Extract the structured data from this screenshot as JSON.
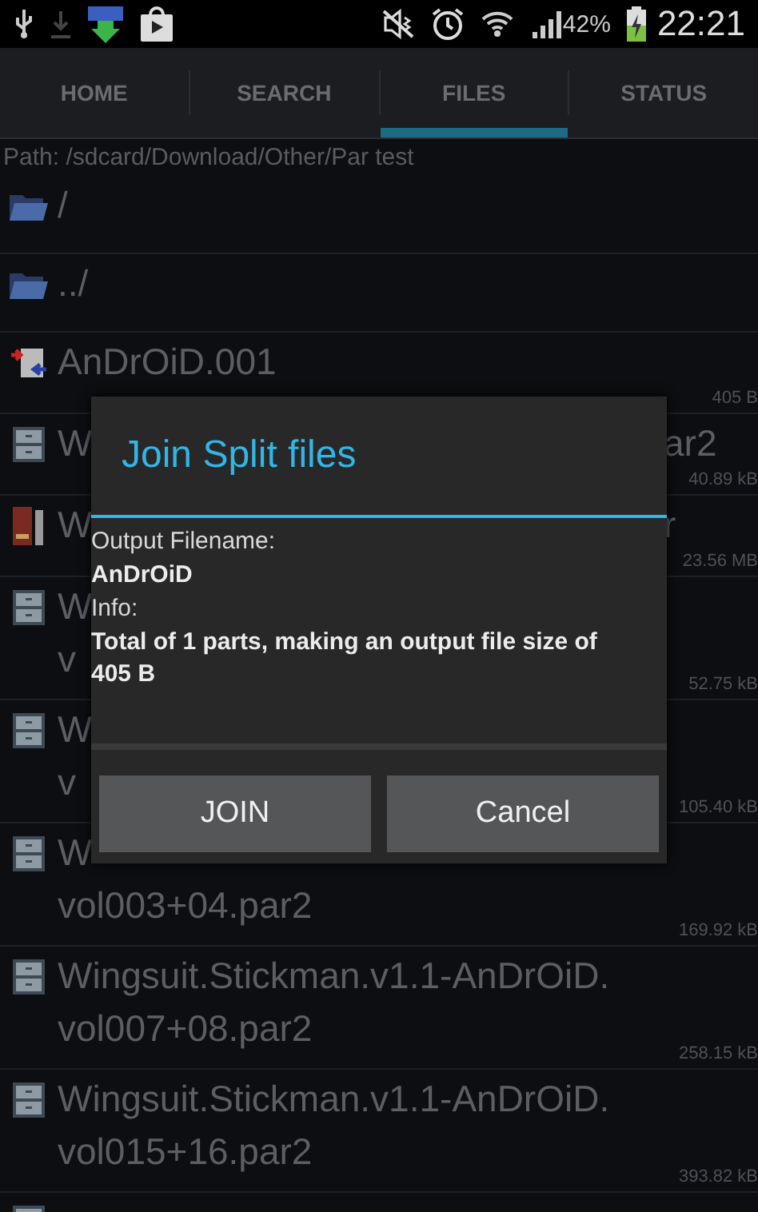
{
  "status_bar": {
    "battery_text": "42%",
    "time": "22:21"
  },
  "tabs": [
    {
      "label": "HOME",
      "selected": false
    },
    {
      "label": "SEARCH",
      "selected": false
    },
    {
      "label": "FILES",
      "selected": true
    },
    {
      "label": "STATUS",
      "selected": false
    }
  ],
  "path": "Path: /sdcard/Download/Other/Par test",
  "files": [
    {
      "kind": "folder",
      "name": "/"
    },
    {
      "kind": "folder",
      "name": "../"
    },
    {
      "kind": "split",
      "name": "AnDrOiD.001",
      "size": "405 B"
    },
    {
      "kind": "par2",
      "name": "W",
      "name_end": "ar2",
      "size": "40.89 kB"
    },
    {
      "kind": "rar",
      "name": "W",
      "name_end": "r",
      "size": "23.56 MB"
    },
    {
      "kind": "par2",
      "name": "W",
      "line2": "v",
      "size": "52.75 kB"
    },
    {
      "kind": "par2",
      "name": "W",
      "line2": "v",
      "size": "105.40 kB"
    },
    {
      "kind": "par2",
      "name": "W",
      "line2": "vol003+04.par2",
      "size": "169.92 kB"
    },
    {
      "kind": "par2",
      "name": "Wingsuit.Stickman.v1.1-AnDrOiD.",
      "line2": "vol007+08.par2",
      "size": "258.15 kB"
    },
    {
      "kind": "par2",
      "name": "Wingsuit.Stickman.v1.1-AnDrOiD.",
      "line2": "vol015+16.par2",
      "size": "393.82 kB"
    },
    {
      "kind": "par2"
    }
  ],
  "dialog": {
    "title": "Join Split files",
    "output_label": "Output Filename:",
    "output_value": "AnDrOiD",
    "info_label": "Info:",
    "info_value": "Total of 1 parts, making an output file size of 405 B",
    "buttons": [
      "JOIN",
      "Cancel"
    ]
  }
}
